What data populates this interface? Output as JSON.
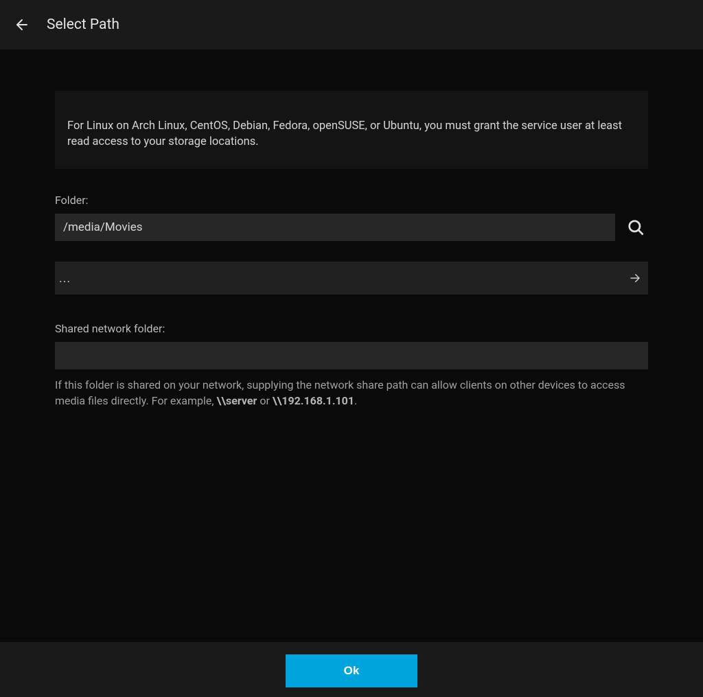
{
  "header": {
    "title": "Select Path"
  },
  "info": {
    "text": "For Linux on Arch Linux, CentOS, Debian, Fedora, openSUSE, or Ubuntu, you must grant the service user at least read access to your storage locations."
  },
  "folder": {
    "label": "Folder:",
    "value": "/media/Movies"
  },
  "nav": {
    "label": "..."
  },
  "network": {
    "label": "Shared network folder:",
    "value": "",
    "help_prefix": "If this folder is shared on your network, supplying the network share path can allow clients on other devices to access media files directly. For example, ",
    "example1": "\\\\server",
    "help_mid": " or ",
    "example2": "\\\\192.168.1.101",
    "help_suffix": "."
  },
  "footer": {
    "ok_label": "Ok"
  }
}
